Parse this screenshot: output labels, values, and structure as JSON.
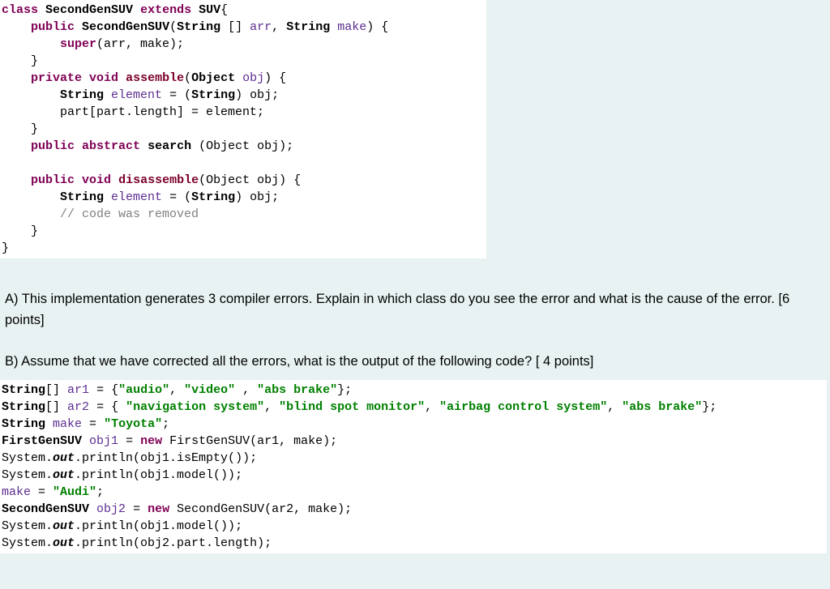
{
  "code1": {
    "l1_kw_class": "class",
    "l1_cls": "SecondGenSUV",
    "l1_kw_extends": "extends",
    "l1_sup": "SUV",
    "l1_brace": "{",
    "l2_kw_public": "public",
    "l2_ctor": "SecondGenSUV",
    "l2_paren_open": "(",
    "l2_type_str": "String",
    "l2_brackets": "[]",
    "l2_arr": "arr",
    "l2_comma": ",",
    "l2_type_str2": "String",
    "l2_make": "make",
    "l2_paren_close": ") {",
    "l3_kw_super": "super",
    "l3_args": "(arr, make);",
    "l4_brace": "}",
    "l5_kw_private": "private",
    "l5_kw_void": "void",
    "l5_method": "assemble",
    "l5_paren_open": "(",
    "l5_type": "Object",
    "l5_obj": "obj",
    "l5_paren_close": ") {",
    "l6_type": "String",
    "l6_var": "element",
    "l6_eq": " = (",
    "l6_cast": "String",
    "l6_castclose": ") obj;",
    "l7_part": "part[part.length]",
    "l7_eq": " = element;",
    "l8_brace": "}",
    "l9_kw_public": "public",
    "l9_kw_abstract": "abstract",
    "l9_method": "search",
    "l9_args": " (Object obj);",
    "l11_kw_public": "public",
    "l11_kw_void": "void",
    "l11_method": "disassemble",
    "l11_args": "(Object obj) {",
    "l12_type": "String",
    "l12_var": "element",
    "l12_eq": " = (",
    "l12_cast": "String",
    "l12_castclose": ") obj;",
    "l13_comment": "// code was removed",
    "l14_brace": "}",
    "l15_brace": "}"
  },
  "questionA": "A) This implementation generates 3 compiler errors. Explain in which class do you see the error and what is the cause of the error. [6 points]",
  "questionB": "B) Assume that we have corrected all the errors, what is the output of the following code? [ 4 points]",
  "code2": {
    "l1_type": "String",
    "l1_brackets": "[]",
    "l1_var": "ar1",
    "l1_eq": " = {",
    "l1_s1": "\"audio\"",
    "l1_c1": ", ",
    "l1_s2": "\"video\"",
    "l1_c2": " , ",
    "l1_s3": "\"abs brake\"",
    "l1_end": "};",
    "l2_type": "String",
    "l2_brackets": "[]",
    "l2_var": "ar2",
    "l2_eq": " = { ",
    "l2_s1": "\"navigation system\"",
    "l2_c1": ", ",
    "l2_s2": "\"blind spot monitor\"",
    "l2_c2": ", ",
    "l2_s3": "\"airbag control system\"",
    "l2_c3": ", ",
    "l2_s4": "\"abs brake\"",
    "l2_end": "};",
    "l3_type": "String",
    "l3_var": "make",
    "l3_eq": " = ",
    "l3_s": "\"Toyota\"",
    "l3_end": ";",
    "l4_type": "FirstGenSUV",
    "l4_var": "obj1",
    "l4_eq": " = ",
    "l4_kw_new": "new",
    "l4_ctor": " FirstGenSUV(ar1, make);",
    "l5_sys": "System.",
    "l5_out": "out",
    "l5_print": ".println(obj1.isEmpty());",
    "l6_sys": "System.",
    "l6_out": "out",
    "l6_print": ".println(obj1.model());",
    "l7_var": "make",
    "l7_eq": " = ",
    "l7_s": "\"Audi\"",
    "l7_end": ";",
    "l8_type": "SecondGenSUV",
    "l8_var": "obj2",
    "l8_eq": " = ",
    "l8_kw_new": "new",
    "l8_ctor": " SecondGenSUV(ar2, make);",
    "l9_sys": "System.",
    "l9_out": "out",
    "l9_print": ".println(obj1.model());",
    "l10_sys": "System.",
    "l10_out": "out",
    "l10_print": ".println(obj2.part.length);"
  }
}
